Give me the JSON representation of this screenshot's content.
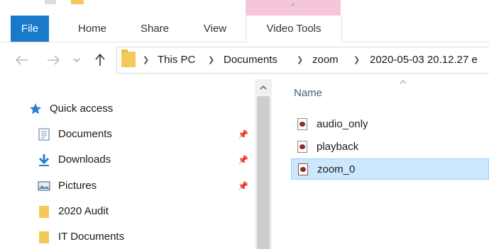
{
  "ribbon": {
    "tabs": {
      "file": "File",
      "home": "Home",
      "share": "Share",
      "view": "View",
      "video_tools": "Video Tools"
    },
    "file_tab_color": "#1979ca",
    "contextual_color": "#f5c6d9"
  },
  "navigation": {
    "back_icon": "arrow-left-icon",
    "forward_icon": "arrow-right-icon",
    "recent_icon": "chevron-down-icon",
    "up_icon": "arrow-up-icon"
  },
  "breadcrumb": {
    "items": [
      "This PC",
      "Documents",
      "zoom",
      "2020-05-03 20.12.27 e"
    ]
  },
  "nav_pane": {
    "items": [
      {
        "label": "Quick access",
        "icon": "star-icon"
      },
      {
        "label": "Documents",
        "icon": "documents-icon",
        "pinned": true
      },
      {
        "label": "Downloads",
        "icon": "download-icon",
        "pinned": true
      },
      {
        "label": "Pictures",
        "icon": "pictures-icon",
        "pinned": true
      },
      {
        "label": "2020 Audit",
        "icon": "folder-icon"
      },
      {
        "label": "IT Documents",
        "icon": "folder-icon"
      }
    ]
  },
  "file_list": {
    "column_name": "Name",
    "files": [
      {
        "name": "audio_only",
        "selected": false
      },
      {
        "name": "playback",
        "selected": false
      },
      {
        "name": "zoom_0",
        "selected": true
      }
    ]
  }
}
